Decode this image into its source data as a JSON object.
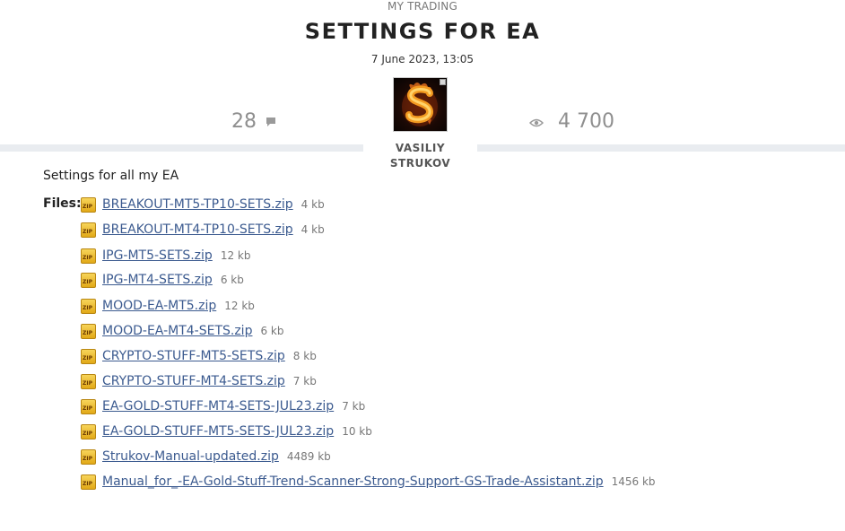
{
  "header": {
    "category": "MY TRADING",
    "title": "SETTINGS FOR EA",
    "date": "7 June 2023, 13:05"
  },
  "stats": {
    "comments_count": "28",
    "comments_icon": "comment-icon",
    "views_count": "4 700",
    "views_icon": "eye-icon"
  },
  "author": {
    "name": "VASILIY STRUKOV",
    "avatar_icon": "flaming-s-avatar"
  },
  "body": {
    "description": "Settings for all my EA",
    "files_label": "Files:",
    "file_icon": "zip-file-icon",
    "files": [
      {
        "name": "BREAKOUT-MT5-TP10-SETS.zip",
        "size": "4 kb"
      },
      {
        "name": "BREAKOUT-MT4-TP10-SETS.zip",
        "size": "4 kb"
      },
      {
        "name": "IPG-MT5-SETS.zip",
        "size": "12 kb"
      },
      {
        "name": "IPG-MT4-SETS.zip",
        "size": "6 kb"
      },
      {
        "name": "MOOD-EA-MT5.zip",
        "size": "12 kb"
      },
      {
        "name": "MOOD-EA-MT4-SETS.zip",
        "size": "6 kb"
      },
      {
        "name": "CRYPTO-STUFF-MT5-SETS.zip",
        "size": "8 kb"
      },
      {
        "name": "CRYPTO-STUFF-MT4-SETS.zip",
        "size": "7 kb"
      },
      {
        "name": "EA-GOLD-STUFF-MT4-SETS-JUL23.zip",
        "size": "7 kb"
      },
      {
        "name": "EA-GOLD-STUFF-MT5-SETS-JUL23.zip",
        "size": "10 kb"
      },
      {
        "name": "Strukov-Manual-updated.zip",
        "size": "4489 kb"
      },
      {
        "name": "Manual_for_-EA-Gold-Stuff-Trend-Scanner-Strong-Support-GS-Trade-Assistant.zip",
        "size": "1456 kb"
      }
    ]
  },
  "colors": {
    "link": "#3b5a8f",
    "muted": "#8f8f8f",
    "divider": "#e9ecf0"
  }
}
